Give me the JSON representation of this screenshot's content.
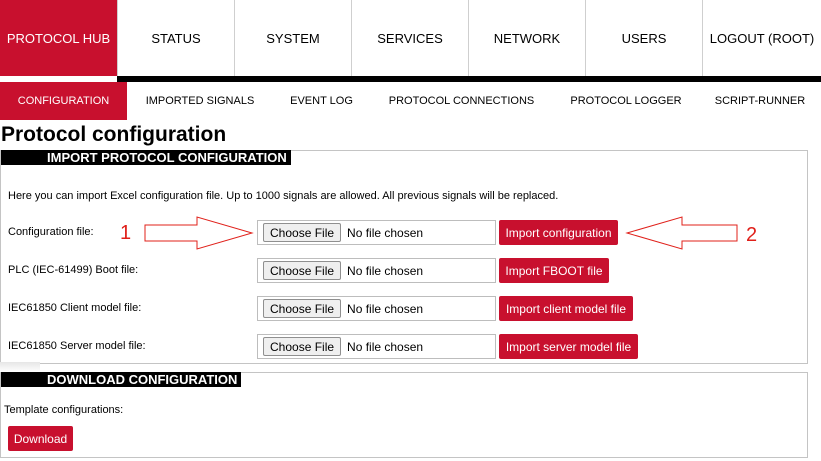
{
  "topnav": {
    "items": [
      {
        "label": "PROTOCOL HUB",
        "active": true
      },
      {
        "label": "STATUS",
        "active": false
      },
      {
        "label": "SYSTEM",
        "active": false
      },
      {
        "label": "SERVICES",
        "active": false
      },
      {
        "label": "NETWORK",
        "active": false
      },
      {
        "label": "USERS",
        "active": false
      },
      {
        "label": "LOGOUT (ROOT)",
        "active": false
      }
    ]
  },
  "subnav": {
    "items": [
      {
        "label": "CONFIGURATION",
        "active": true
      },
      {
        "label": "IMPORTED SIGNALS",
        "active": false
      },
      {
        "label": "EVENT LOG",
        "active": false
      },
      {
        "label": "PROTOCOL CONNECTIONS",
        "active": false
      },
      {
        "label": "PROTOCOL LOGGER",
        "active": false
      },
      {
        "label": "SCRIPT-RUNNER",
        "active": false
      }
    ]
  },
  "page": {
    "title": "Protocol configuration"
  },
  "import_section": {
    "header": "IMPORT PROTOCOL CONFIGURATION",
    "description": "Here you can import Excel configuration file. Up to 1000 signals are allowed. All previous signals will be replaced.",
    "rows": [
      {
        "label": "Configuration file:",
        "choose_label": "Choose File",
        "file_status": "No file chosen",
        "button_label": "Import configuration"
      },
      {
        "label": "PLC (IEC-61499) Boot file:",
        "choose_label": "Choose File",
        "file_status": "No file chosen",
        "button_label": "Import FBOOT file"
      },
      {
        "label": "IEC61850 Client model file:",
        "choose_label": "Choose File",
        "file_status": "No file chosen",
        "button_label": "Import client model file"
      },
      {
        "label": "IEC61850 Server model file:",
        "choose_label": "Choose File",
        "file_status": "No file chosen",
        "button_label": "Import server model file"
      }
    ]
  },
  "download_section": {
    "header": "DOWNLOAD CONFIGURATION",
    "template_label": "Template configurations:",
    "download_label": "Download"
  },
  "annotations": {
    "marker_1": "1",
    "marker_2": "2"
  },
  "colors": {
    "accent": "#c8102e",
    "annotation": "#e0201a",
    "header_bg": "#000000"
  }
}
